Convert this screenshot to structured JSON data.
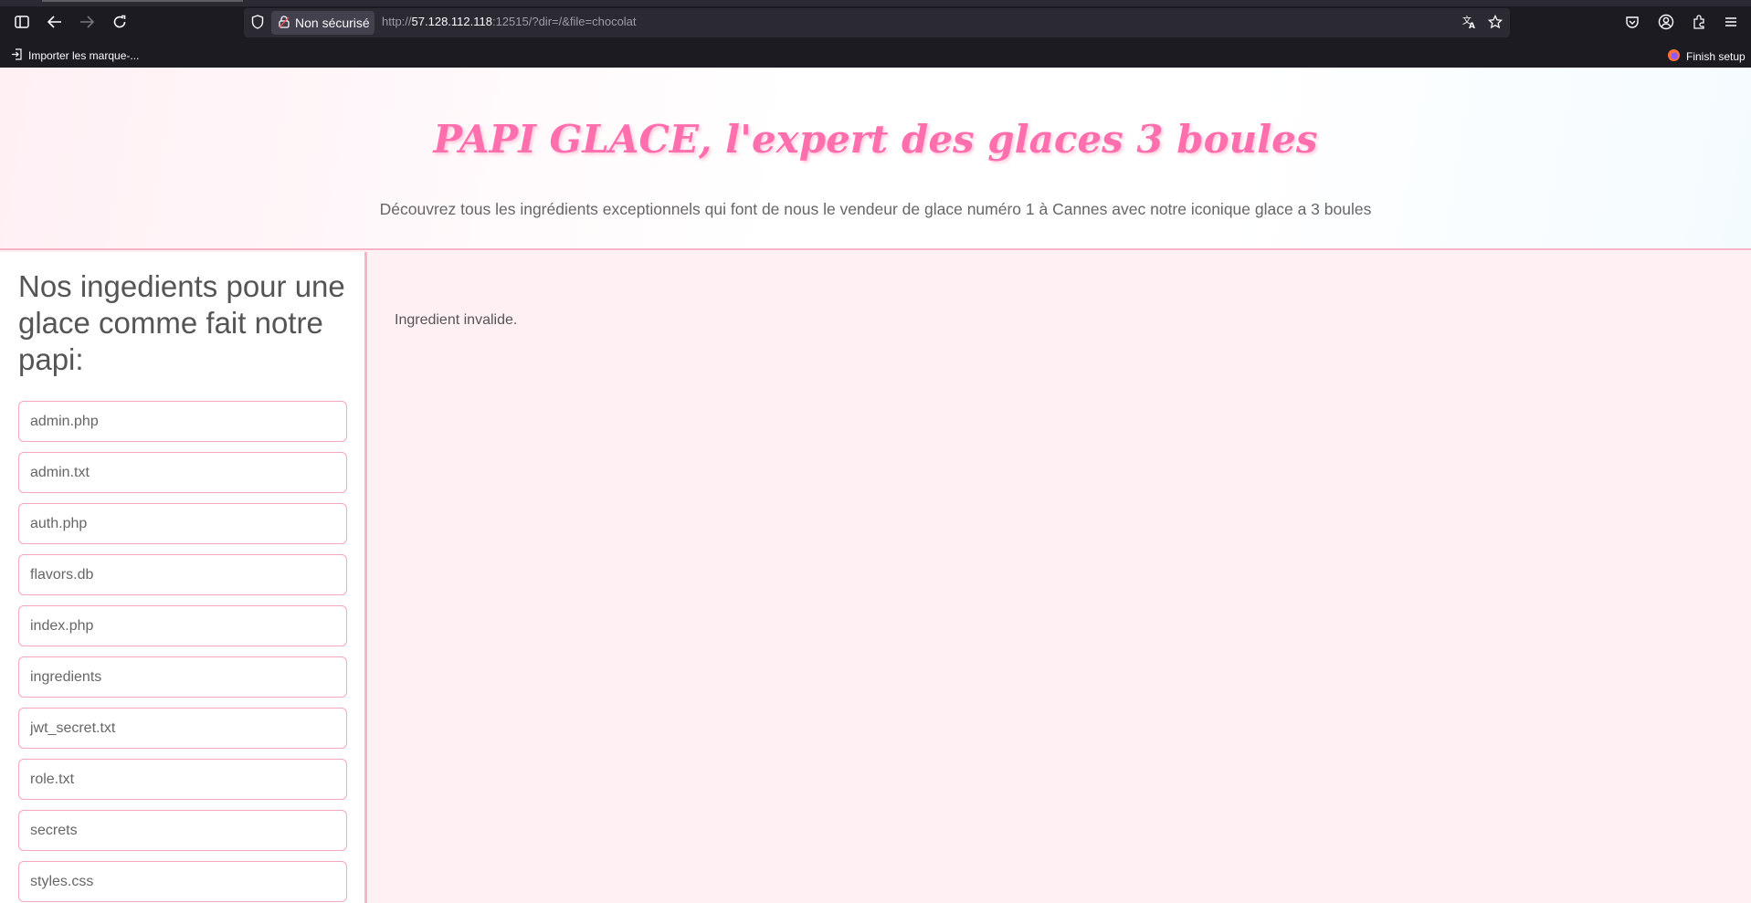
{
  "browser": {
    "security_label": "Non sécurisé",
    "url_prefix": "http://",
    "url_host": "57.128.112.118",
    "url_rest": ":12515/?dir=/&file=chocolat",
    "icons": [
      "sidebar-icon",
      "back-icon",
      "forward-icon",
      "reload-icon",
      "shield-icon",
      "lock-icon",
      "translate-icon",
      "star-icon",
      "pocket-icon",
      "account-icon",
      "extensions-icon",
      "menu-icon"
    ]
  },
  "bookmarks": {
    "import_label": "Importer les marque-...",
    "finish_label": "Finish setup"
  },
  "header": {
    "title": "PAPI GLACE, l'expert des glaces 3 boules",
    "subtitle": "Découvrez tous les ingrédients exceptionnels qui font de nous le vendeur de glace numéro 1 à Cannes avec notre iconique glace a 3 boules"
  },
  "sidebar": {
    "title": "Nos ingedients pour une glace comme fait notre papi:",
    "files": [
      "admin.php",
      "admin.txt",
      "auth.php",
      "flavors.db",
      "index.php",
      "ingredients",
      "jwt_secret.txt",
      "role.txt",
      "secrets",
      "styles.css"
    ]
  },
  "main": {
    "message": "Ingredient invalide."
  },
  "colors": {
    "accent": "#ff6fae",
    "border": "#f8b4c6",
    "page_bg": "#fff0f4",
    "chrome_bg": "#1c1b22"
  }
}
